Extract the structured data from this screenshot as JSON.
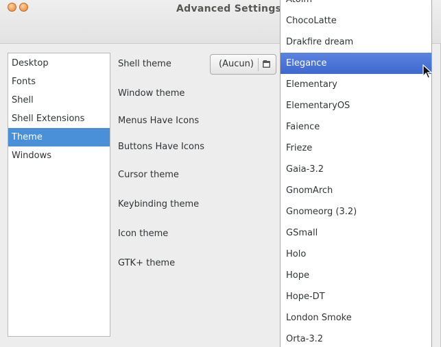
{
  "window": {
    "title": "Advanced Settings"
  },
  "sidebar": {
    "items": [
      {
        "label": "Desktop",
        "selected": false
      },
      {
        "label": "Fonts",
        "selected": false
      },
      {
        "label": "Shell",
        "selected": false
      },
      {
        "label": "Shell Extensions",
        "selected": false
      },
      {
        "label": "Theme",
        "selected": true
      },
      {
        "label": "Windows",
        "selected": false
      }
    ]
  },
  "settings": {
    "labels": [
      "Shell theme",
      "Window theme",
      "Menus Have Icons",
      "Buttons Have Icons",
      "Cursor theme",
      "Keybinding theme",
      "Icon theme",
      "GTK+ theme"
    ],
    "shell_theme_value": "(Aucun)",
    "shell_theme_button_icon": "folder-open-icon"
  },
  "dropdown": {
    "items": [
      "Atolm",
      "ChocoLatte",
      "Drakfire dream",
      "Elegance",
      "Elementary",
      "ElementaryOS",
      "Faience",
      "Frieze",
      "Gaia-3.2",
      "GnomArch",
      "Gnomeorg (3.2)",
      "GSmall",
      "Holo",
      "Hope",
      "Hope-DT",
      "London Smoke",
      "Orta-3.2"
    ],
    "highlighted": "Elegance"
  },
  "colors": {
    "selection": "#4a90d9",
    "menu_highlight": "#4a74d6",
    "window_bg": "#ededed"
  }
}
